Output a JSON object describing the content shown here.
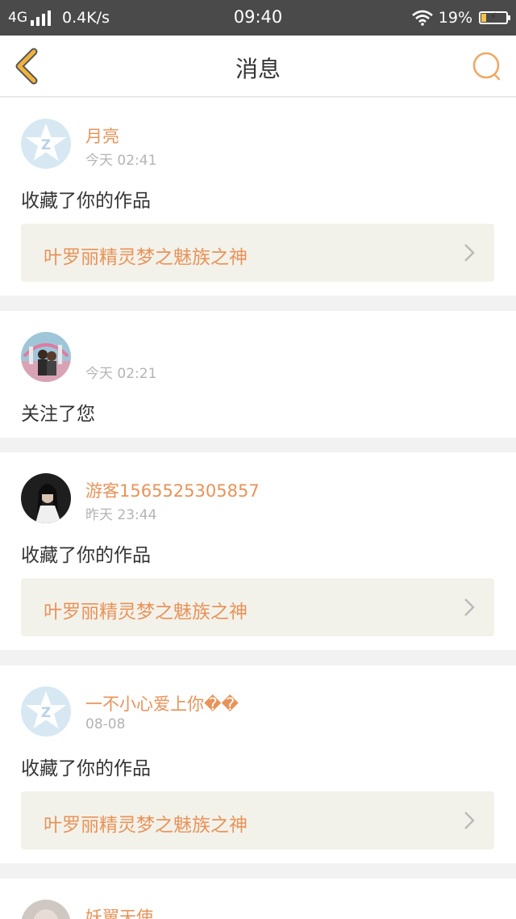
{
  "status_bar": {
    "network": "4G",
    "speed": "0.4K/s",
    "time": "09:40",
    "battery": "19%",
    "battery_level": 0.19
  },
  "header": {
    "title": "消息"
  },
  "colors": {
    "accent": "#e8935a",
    "back_icon": "#f0b23c",
    "status_bar_bg": "#4a4a4a"
  },
  "notifications": [
    {
      "user": "月亮",
      "time": "今天 02:41",
      "action": "收藏了你的作品",
      "work_title": "叶罗丽精灵梦之魅族之神"
    },
    {
      "user": "",
      "time": "今天 02:21",
      "action": "关注了您"
    },
    {
      "user": "游客1565525305857",
      "time": "昨天 23:44",
      "action": "收藏了你的作品",
      "work_title": "叶罗丽精灵梦之魅族之神"
    },
    {
      "user": "一不小心爱上你��",
      "time": "08-08",
      "action": "收藏了你的作品",
      "work_title": "叶罗丽精灵梦之魅族之神"
    },
    {
      "user": "妖翼天使"
    }
  ]
}
